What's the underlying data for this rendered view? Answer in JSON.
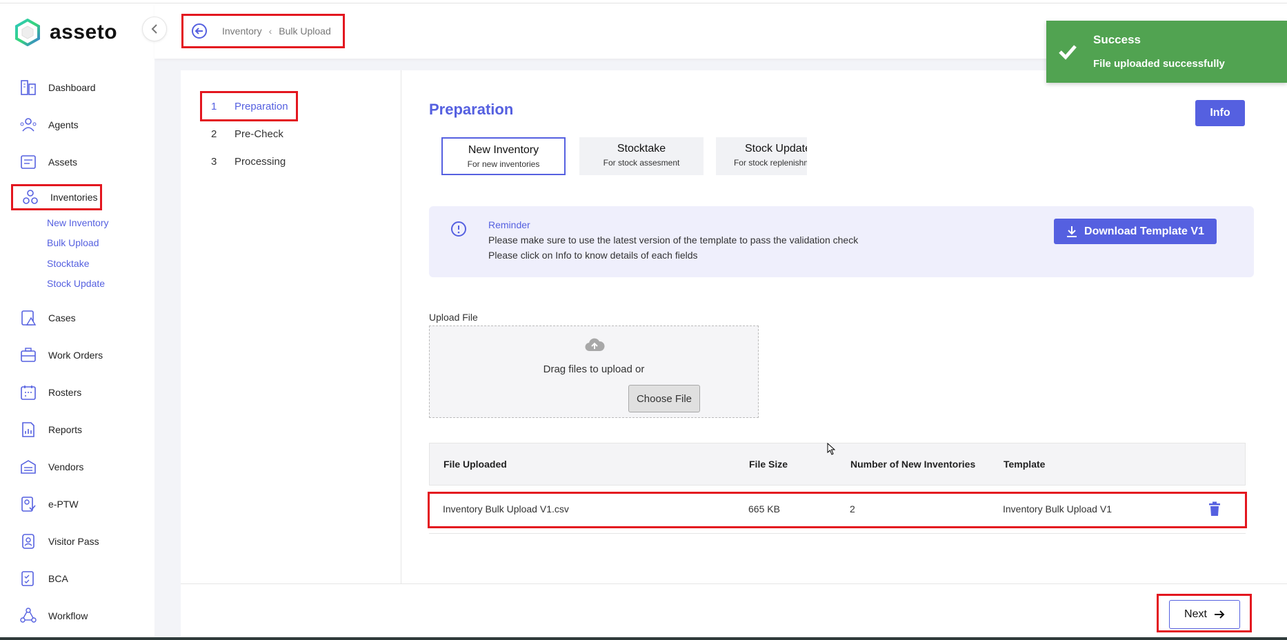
{
  "app": {
    "name": "asseto"
  },
  "breadcrumb": {
    "parent": "Inventory",
    "current": "Bulk Upload"
  },
  "sidebar": {
    "items": [
      {
        "id": "dashboard",
        "label": "Dashboard",
        "icon": "dashboard-icon"
      },
      {
        "id": "agents",
        "label": "Agents",
        "icon": "agents-icon"
      },
      {
        "id": "assets",
        "label": "Assets",
        "icon": "assets-icon"
      },
      {
        "id": "inventories",
        "label": "Inventories",
        "icon": "inventories-icon"
      },
      {
        "id": "cases",
        "label": "Cases",
        "icon": "cases-icon"
      },
      {
        "id": "work-orders",
        "label": "Work Orders",
        "icon": "work-orders-icon"
      },
      {
        "id": "rosters",
        "label": "Rosters",
        "icon": "rosters-icon"
      },
      {
        "id": "reports",
        "label": "Reports",
        "icon": "reports-icon"
      },
      {
        "id": "vendors",
        "label": "Vendors",
        "icon": "vendors-icon"
      },
      {
        "id": "eptw",
        "label": "e-PTW",
        "icon": "eptw-icon"
      },
      {
        "id": "visitor-pass",
        "label": "Visitor Pass",
        "icon": "visitor-pass-icon"
      },
      {
        "id": "bca",
        "label": "BCA",
        "icon": "bca-icon"
      },
      {
        "id": "workflow",
        "label": "Workflow",
        "icon": "workflow-icon"
      }
    ],
    "subitems": [
      "New Inventory",
      "Bulk Upload",
      "Stocktake",
      "Stock Update"
    ]
  },
  "steps": [
    {
      "num": "1",
      "label": "Preparation"
    },
    {
      "num": "2",
      "label": "Pre-Check"
    },
    {
      "num": "3",
      "label": "Processing"
    }
  ],
  "main": {
    "title": "Preparation",
    "info_label": "Info",
    "types": [
      {
        "title": "New Inventory",
        "sub": "For new inventories"
      },
      {
        "title": "Stocktake",
        "sub": "For stock assesment"
      },
      {
        "title": "Stock Update",
        "sub": "For stock replenishment"
      }
    ],
    "reminder": {
      "title": "Reminder",
      "line1": "Please make sure to use the latest version of the template to pass the validation check",
      "line2": "Please click on Info to know details of each fields",
      "button": "Download Template V1"
    },
    "upload": {
      "label": "Upload File",
      "drag_text": "Drag files to upload or",
      "choose_label": "Choose File"
    },
    "table": {
      "headers": [
        "File Uploaded",
        "File Size",
        "Number of New Inventories",
        "Template"
      ],
      "rows": [
        [
          "Inventory Bulk Upload V1.csv",
          "665 KB",
          "2",
          "Inventory Bulk Upload V1"
        ]
      ]
    },
    "next_label": "Next"
  },
  "toast": {
    "title": "Success",
    "message": "File uploaded successfully"
  },
  "colors": {
    "accent": "#5560e0",
    "success": "#51a351",
    "highlight": "#e3161f"
  }
}
